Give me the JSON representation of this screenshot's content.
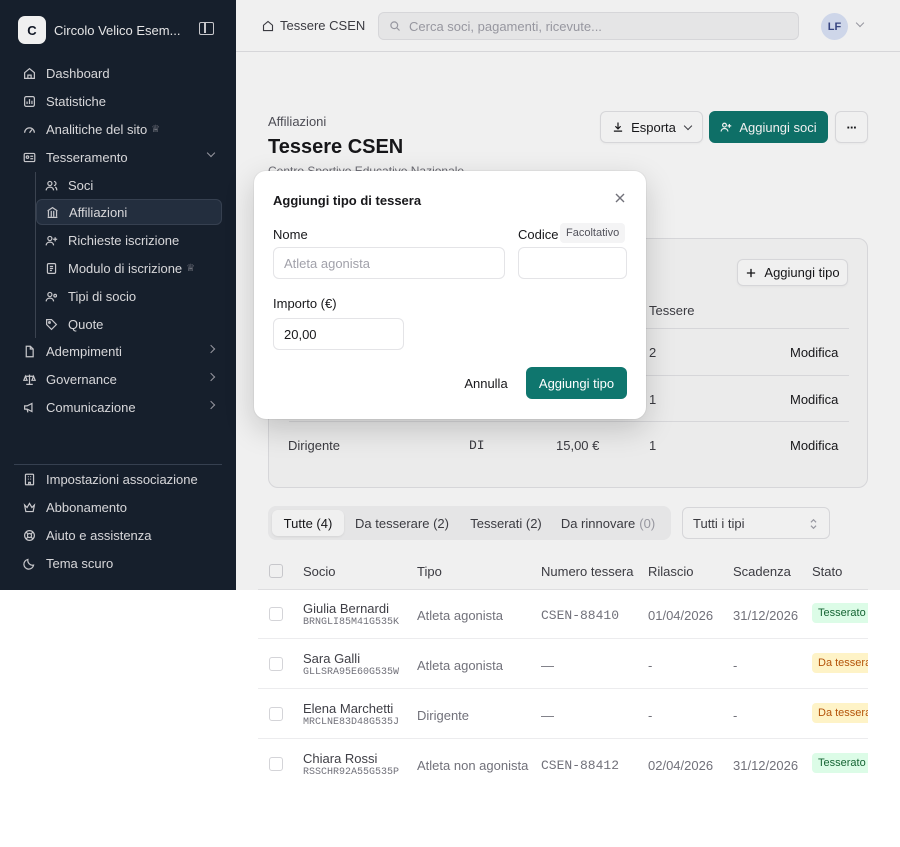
{
  "sidebar": {
    "org_initial": "C",
    "org_name": "Circolo Velico Esem...",
    "nav": {
      "dashboard": "Dashboard",
      "statistiche": "Statistiche",
      "analitiche": "Analitiche del sito",
      "tesseramento": "Tesseramento",
      "soci": "Soci",
      "affiliazioni": "Affiliazioni",
      "richieste": "Richieste iscrizione",
      "modulo": "Modulo di iscrizione",
      "tipi_socio": "Tipi di socio",
      "quote": "Quote",
      "adempimenti": "Adempimenti",
      "governance": "Governance",
      "comunicazione": "Comunicazione"
    },
    "footer": {
      "impostazioni": "Impostazioni associazione",
      "abbonamento": "Abbonamento",
      "aiuto": "Aiuto e assistenza",
      "tema": "Tema scuro"
    }
  },
  "topbar": {
    "breadcrumb": "Tessere CSEN",
    "search_placeholder": "Cerca soci, pagamenti, ricevute...",
    "avatar_initials": "LF"
  },
  "page": {
    "breadcrumb": "Affiliazioni",
    "title": "Tessere CSEN",
    "subtitle": "Centro Sportivo Educativo Nazionale",
    "export_label": "Esporta",
    "add_members_label": "Aggiungi soci",
    "more_label": "···"
  },
  "types_card": {
    "add_type_label": "Aggiungi tipo",
    "col_tessere": "Tessere",
    "edit_label": "Modifica",
    "rows": [
      {
        "tessere": "2"
      },
      {
        "tessere": "1"
      },
      {
        "name": "Dirigente",
        "code": "DI",
        "amount": "15,00 €",
        "tessere": "1"
      }
    ]
  },
  "tabs": {
    "all": "Tutte (4)",
    "to_issue": "Da tesserare (2)",
    "issued": "Tesserati (2)",
    "renew": "Da rinnovare",
    "renew_count": "(0)",
    "filter": "Tutti i tipi"
  },
  "members": {
    "headers": {
      "socio": "Socio",
      "tipo": "Tipo",
      "numero": "Numero tessera",
      "rilascio": "Rilascio",
      "scadenza": "Scadenza",
      "stato": "Stato"
    },
    "rows": [
      {
        "name": "Giulia Bernardi",
        "cf": "BRNGLI85M41G535K",
        "type": "Atleta agonista",
        "number": "CSEN-88410",
        "issued": "01/04/2026",
        "expiry": "31/12/2026",
        "status": "Tesserato"
      },
      {
        "name": "Sara Galli",
        "cf": "GLLSRA95E60G535W",
        "type": "Atleta agonista",
        "number": "—",
        "issued": "-",
        "expiry": "-",
        "status": "Da tesserare"
      },
      {
        "name": "Elena Marchetti",
        "cf": "MRCLNE83D48G535J",
        "type": "Dirigente",
        "number": "—",
        "issued": "-",
        "expiry": "-",
        "status": "Da tesserare"
      },
      {
        "name": "Chiara Rossi",
        "cf": "RSSCHR92A55G535P",
        "type": "Atleta non agonista",
        "number": "CSEN-88412",
        "issued": "02/04/2026",
        "expiry": "31/12/2026",
        "status": "Tesserato"
      }
    ]
  },
  "modal": {
    "title": "Aggiungi tipo di tessera",
    "name_label": "Nome",
    "name_placeholder": "Atleta agonista",
    "code_label": "Codice",
    "optional_label": "Facoltativo",
    "amount_label": "Importo (€)",
    "amount_value": "20,00",
    "cancel_label": "Annulla",
    "submit_label": "Aggiungi tipo"
  },
  "colors": {
    "sidebar_bg": "#18212f",
    "primary": "#0f766e",
    "success_bg": "#dcfce7",
    "warning_bg": "#fef3c7"
  },
  "icons": {
    "org": "org-logo",
    "toggle": "sidebar-toggle-icon",
    "home": "home-icon",
    "search": "search-icon",
    "download": "download-icon",
    "user_plus": "user-plus-icon",
    "plus": "plus-icon",
    "close": "close-icon",
    "crown": "crown-icon"
  }
}
